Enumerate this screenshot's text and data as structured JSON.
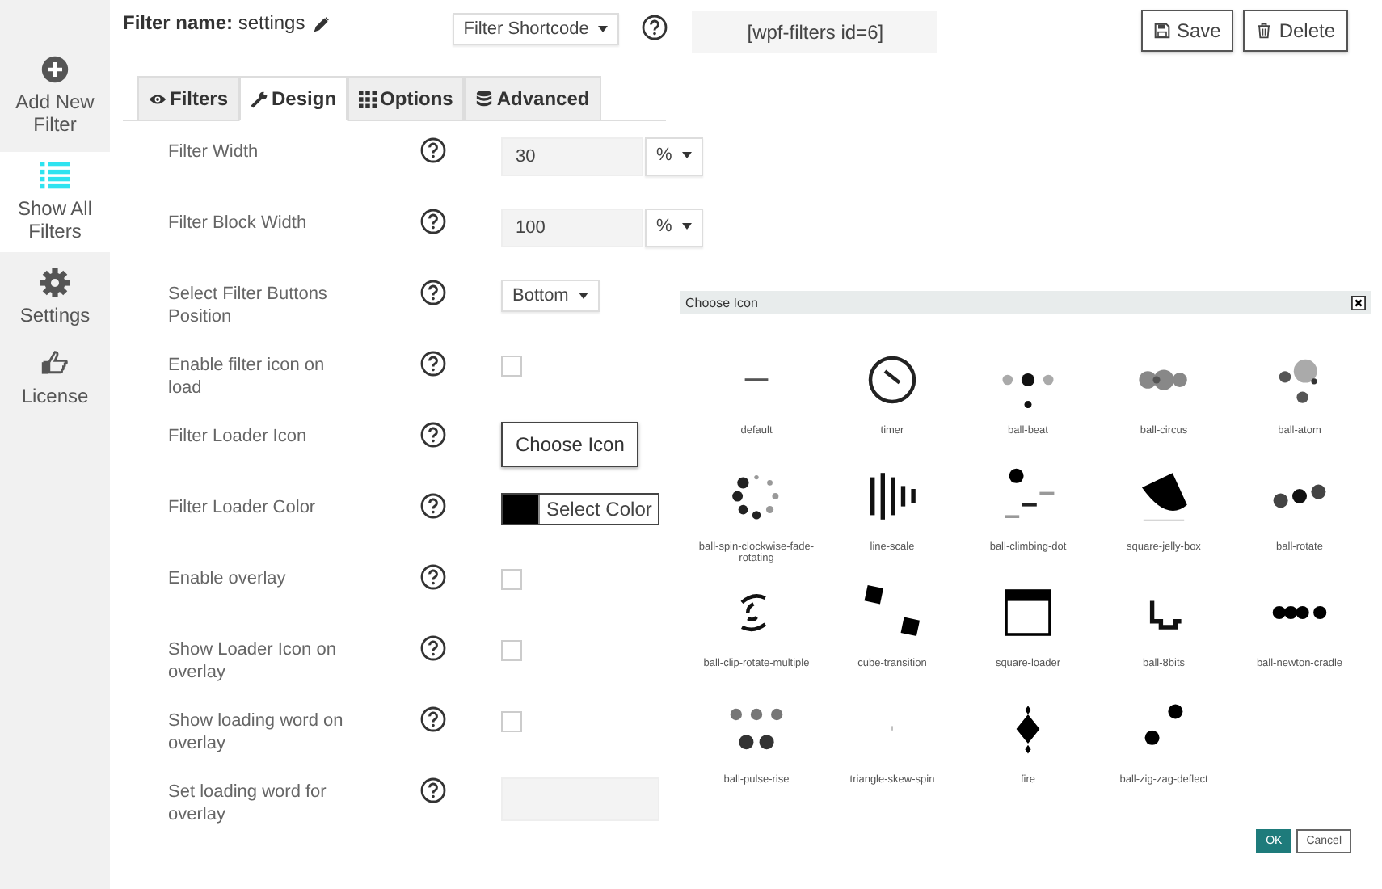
{
  "sidebar": {
    "items": [
      {
        "kind": "plus",
        "label": "Add New Filter",
        "selected": false
      },
      {
        "kind": "list",
        "label": "Show All Filters",
        "selected": true
      },
      {
        "kind": "gear",
        "label": "Settings",
        "selected": false
      },
      {
        "kind": "hand",
        "label": "License",
        "selected": false
      }
    ]
  },
  "header": {
    "name_label": "Filter name:",
    "name_value": "settings",
    "shortcode_select": "Filter Shortcode",
    "shortcode": "[wpf-filters id=6]",
    "buttons": [
      {
        "kind": "save",
        "label": "Save"
      },
      {
        "kind": "delete",
        "label": "Delete"
      }
    ]
  },
  "tabs": [
    {
      "kind": "eye",
      "label": "Filters",
      "selected": false
    },
    {
      "kind": "wrench",
      "label": "Design",
      "selected": true
    },
    {
      "kind": "grid",
      "label": "Options",
      "selected": false
    },
    {
      "kind": "database",
      "label": "Advanced",
      "selected": false
    }
  ],
  "settings": [
    {
      "kind": "unit",
      "label": "Filter Width",
      "value": "30",
      "unit": "%"
    },
    {
      "kind": "unit",
      "label": "Filter Block Width",
      "value": "100",
      "unit": "%"
    },
    {
      "kind": "select",
      "label": "Select Filter Buttons Position",
      "value": "Bottom"
    },
    {
      "kind": "checkbox",
      "label": "Enable filter icon on load",
      "checked": false
    },
    {
      "kind": "button",
      "label": "Filter Loader Icon",
      "button": "Choose Icon"
    },
    {
      "kind": "color",
      "label": "Filter Loader Color",
      "button": "Select Color",
      "color": "#000000"
    },
    {
      "kind": "checkbox",
      "label": "Enable overlay",
      "checked": false
    },
    {
      "kind": "checkbox",
      "label": "Show Loader Icon on overlay",
      "checked": false
    },
    {
      "kind": "checkbox",
      "label": "Show loading word on overlay",
      "checked": false
    },
    {
      "kind": "text",
      "label": "Set loading word for overlay"
    }
  ],
  "dialog": {
    "title": "Choose Icon",
    "icons": [
      {
        "kind": "line",
        "label": "default"
      },
      {
        "kind": "clock",
        "label": "timer"
      },
      {
        "kind": "beat",
        "label": "ball-beat"
      },
      {
        "kind": "circus",
        "label": "ball-circus"
      },
      {
        "kind": "atom",
        "label": "ball-atom"
      },
      {
        "kind": "spin",
        "label": "ball-spin-clockwise-fade-rotating"
      },
      {
        "kind": "bars",
        "label": "line-scale"
      },
      {
        "kind": "climb",
        "label": "ball-climbing-dot"
      },
      {
        "kind": "jelly",
        "label": "square-jelly-box"
      },
      {
        "kind": "rotate",
        "label": "ball-rotate"
      },
      {
        "kind": "clip",
        "label": "ball-clip-rotate-multiple"
      },
      {
        "kind": "cubes",
        "label": "cube-transition"
      },
      {
        "kind": "window",
        "label": "square-loader"
      },
      {
        "kind": "bits",
        "label": "ball-8bits"
      },
      {
        "kind": "cradle",
        "label": "ball-newton-cradle"
      },
      {
        "kind": "pulse",
        "label": "ball-pulse-rise"
      },
      {
        "kind": "tick",
        "label": "triangle-skew-spin"
      },
      {
        "kind": "diamond",
        "label": "fire"
      },
      {
        "kind": "zigzag",
        "label": "ball-zig-zag-deflect"
      }
    ],
    "buttons": [
      {
        "kind": "primary",
        "label": "OK"
      },
      {
        "kind": "secondary",
        "label": "Cancel"
      }
    ]
  }
}
